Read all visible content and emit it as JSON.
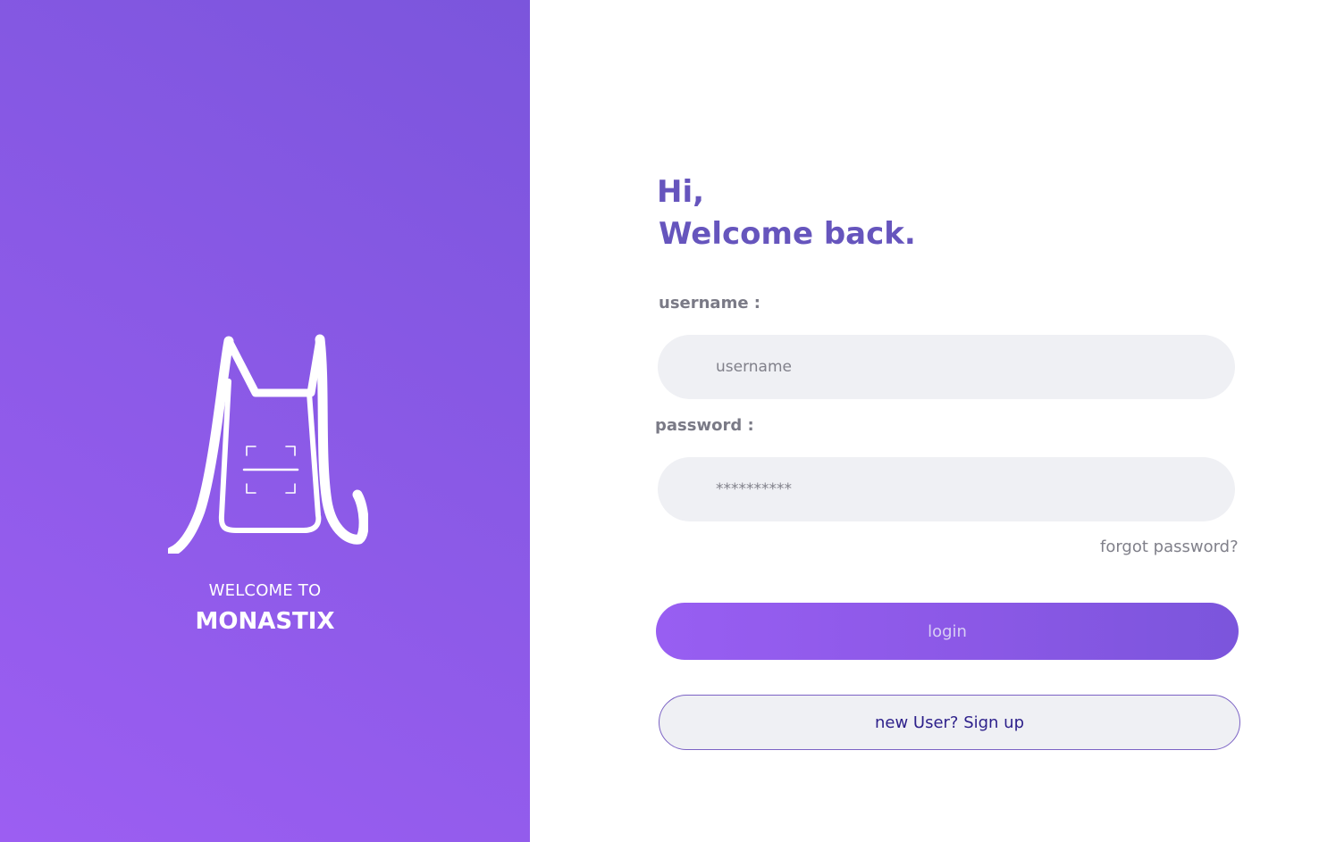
{
  "brand": {
    "welcome_to": "WELCOME TO",
    "name": "MONASTIX",
    "logo_icon": "monastix-logo-icon"
  },
  "greeting": {
    "line1": "Hi,",
    "line2": "Welcome back."
  },
  "form": {
    "username_label": "username :",
    "username_placeholder": "username",
    "password_label": "password :",
    "password_placeholder": "**********",
    "forgot_label": "forgot password?",
    "login_label": "login",
    "signup_label": "new User? Sign up"
  },
  "colors": {
    "accent": "#8d5ae8",
    "heading": "#6655bd",
    "input_bg": "#eff0f4"
  }
}
